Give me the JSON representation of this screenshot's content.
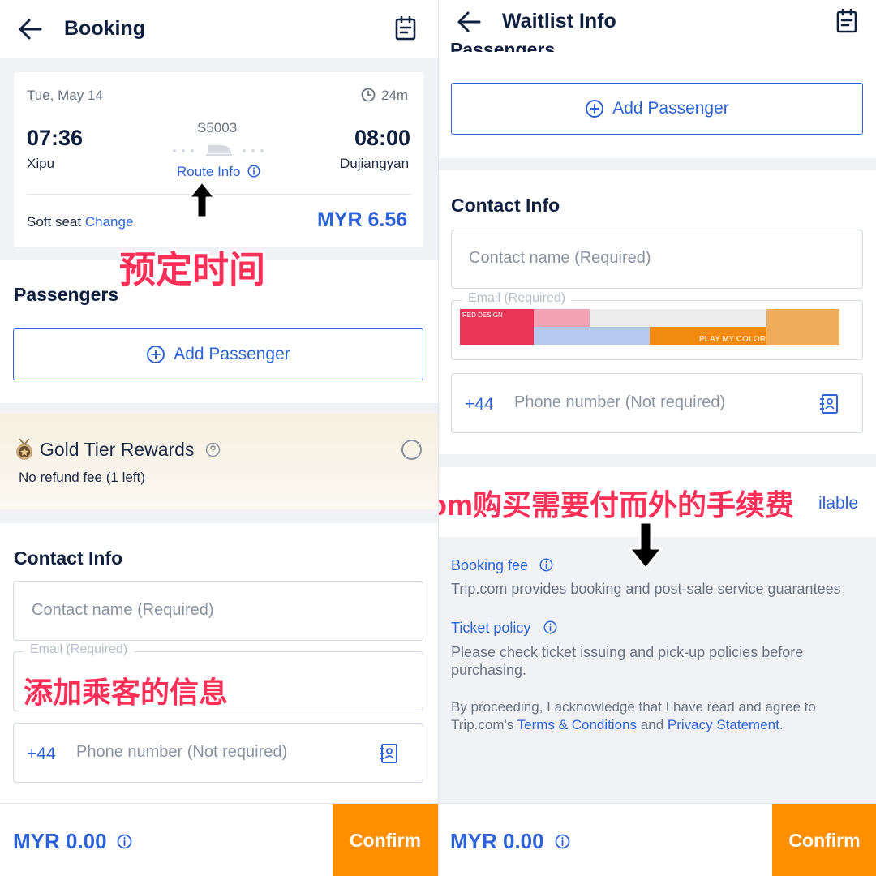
{
  "left": {
    "header": {
      "title": "Booking"
    },
    "trip": {
      "date": "Tue, May 14",
      "duration": "24m",
      "depart_time": "07:36",
      "depart_station": "Xipu",
      "train_no": "S5003",
      "route_info": "Route Info",
      "arrive_time": "08:00",
      "arrive_station": "Dujiangyan",
      "seat": "Soft seat",
      "change": "Change",
      "price": "MYR 6.56"
    },
    "annotation_time": "预定时间",
    "passengers": {
      "title": "Passengers",
      "add": "Add Passenger"
    },
    "rewards": {
      "title": "Gold Tier Rewards",
      "sub": "No refund fee (1 left)"
    },
    "contact": {
      "title": "Contact Info",
      "name_placeholder": "Contact name (Required)",
      "email_label": "Email (Required)",
      "country_code": "+44",
      "phone_placeholder": "Phone number (Not required)"
    },
    "annotation_contact": "添加乘客的信息",
    "footer": {
      "total": "MYR 0.00",
      "confirm": "Confirm"
    }
  },
  "right": {
    "header": {
      "title": "Waitlist Info",
      "cut_text": "Passengers"
    },
    "passengers": {
      "add": "Add Passenger"
    },
    "contact": {
      "title": "Contact Info",
      "name_placeholder": "Contact name (Required)",
      "email_label": "Email (Required)",
      "country_code": "+44",
      "phone_placeholder": "Phone number (Not required)"
    },
    "sticker": {
      "brand": "RED DESIGN",
      "tagline": "PLAY MY COLOR"
    },
    "available_fragment": "ilable",
    "annotation_fee": "在Trip.com购买需要付而外的手续费",
    "booking_fee": {
      "title": "Booking fee",
      "desc": "Trip.com provides booking and post-sale service guarantees"
    },
    "ticket_policy": {
      "title": "Ticket policy",
      "desc": "Please check ticket issuing and pick-up policies before purchasing."
    },
    "legal": {
      "prefix": "By proceeding, I acknowledge that I have read and agree to Trip.com's",
      "terms": "Terms & Conditions",
      "and": "and",
      "privacy": "Privacy Statement",
      "end": "."
    },
    "footer": {
      "total": "MYR 0.00",
      "confirm": "Confirm"
    }
  },
  "colors": {
    "brand_blue": "#2e63d8",
    "navy": "#0f1f3d",
    "confirm_orange": "#ff8f00",
    "annotation_red": "#ff2f58"
  }
}
